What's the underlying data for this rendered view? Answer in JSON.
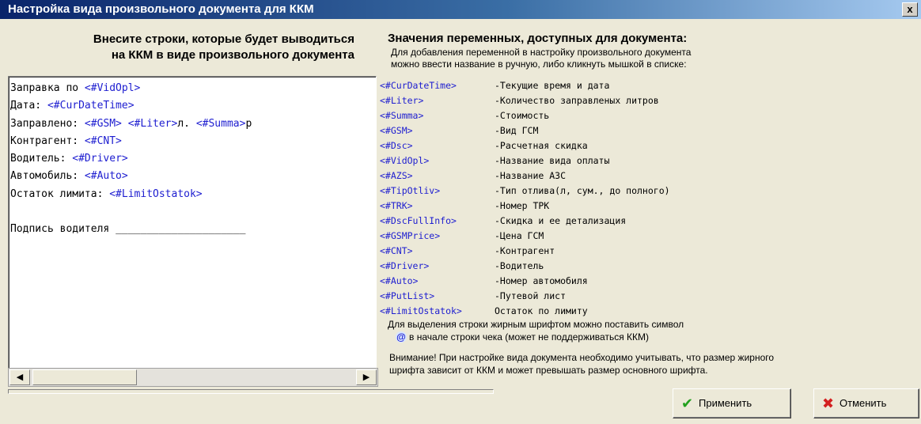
{
  "window": {
    "title": "Настройка вида произвольного документа для ККМ",
    "close_label": "x"
  },
  "left": {
    "heading_line1": "Внесите строки, которые будет выводиться",
    "heading_line2": "на ККМ в виде произвольного документа"
  },
  "memo_lines": [
    {
      "text": "Заправка по ",
      "var": "<#VidOpl>",
      "rest": ""
    },
    {
      "text": "Дата: ",
      "var": "<#CurDateTime>",
      "rest": ""
    },
    {
      "text": "Заправлено: ",
      "var": "<#GSM> <#Liter>",
      "rest": "л. ",
      "var2": "<#Summa>",
      "rest2": "р"
    },
    {
      "text": "Контрагент: ",
      "var": "<#CNT>",
      "rest": ""
    },
    {
      "text": "Водитель: ",
      "var": "<#Driver>",
      "rest": ""
    },
    {
      "text": "Автомобиль: ",
      "var": "<#Auto>",
      "rest": ""
    },
    {
      "text": "Остаток лимита: ",
      "var": "<#LimitOstatok>",
      "rest": ""
    },
    {
      "text": "",
      "var": "",
      "rest": ""
    },
    {
      "text": "Подпись водителя ",
      "var": "",
      "rest": "_____________________"
    }
  ],
  "right": {
    "heading": "Значения переменных, доступных для документа:",
    "hint_line1": "Для добавления переменной в настройку произвольного документа",
    "hint_line2": "можно ввести название в ручную, либо кликнуть мышкой в списке:"
  },
  "variables": [
    {
      "name": "<#CurDateTime>",
      "desc": "-Текущие время и дата"
    },
    {
      "name": "<#Liter>",
      "desc": "-Количество заправленых литров"
    },
    {
      "name": "<#Summa>",
      "desc": "-Стоимость"
    },
    {
      "name": "<#GSM>",
      "desc": "-Вид ГСМ"
    },
    {
      "name": "<#Dsc>",
      "desc": "-Расчетная скидка"
    },
    {
      "name": "<#VidOpl>",
      "desc": "-Название вида оплаты"
    },
    {
      "name": "<#AZS>",
      "desc": "-Название АЗС"
    },
    {
      "name": "<#TipOtliv>",
      "desc": "-Тип отлива(л, сум., до полного)"
    },
    {
      "name": "<#TRK>",
      "desc": "-Номер ТРК"
    },
    {
      "name": "<#DscFullInfo>",
      "desc": "-Скидка и ее детализация"
    },
    {
      "name": "<#GSMPrice>",
      "desc": "-Цена ГСМ"
    },
    {
      "name": "<#CNT>",
      "desc": "-Контрагент"
    },
    {
      "name": "<#Driver>",
      "desc": "-Водитель"
    },
    {
      "name": "<#Auto>",
      "desc": "-Номер автомобиля"
    },
    {
      "name": "<#PutList>",
      "desc": "-Путевой лист"
    },
    {
      "name": "<#LimitOstatok>",
      "desc": "Остаток по лимиту"
    }
  ],
  "notes": {
    "bold_line1": "Для выделения строки жирным шрифтом можно поставить символ",
    "at_symbol": "@",
    "bold_line2": "в начале строки чека (может не поддерживаться ККМ)",
    "warning_line1": "Внимание! При настройке вида документа необходимо учитывать, что размер жирного",
    "warning_line2": "шрифта зависит от ККМ и может превышать размер основного шрифта."
  },
  "scrollbar": {
    "left_arrow": "◀",
    "right_arrow": "▶"
  },
  "buttons": {
    "apply": "Применить",
    "cancel": "Отменить"
  },
  "icons": {
    "apply": "checkmark-icon",
    "cancel": "cross-icon"
  }
}
